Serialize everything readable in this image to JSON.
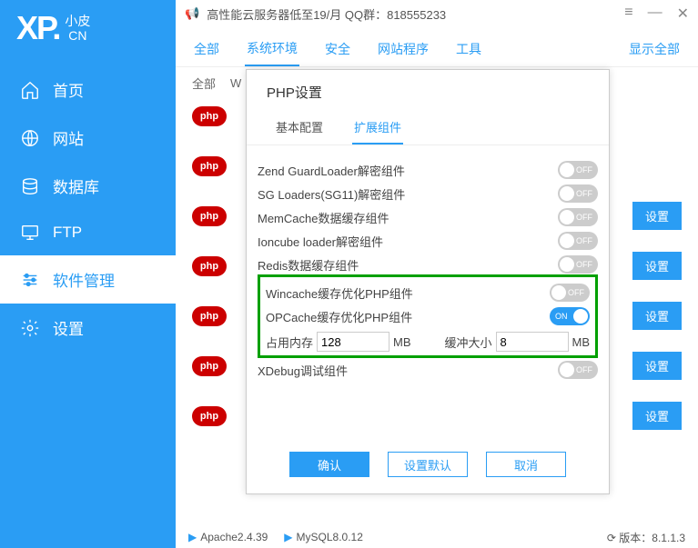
{
  "topbar": {
    "promo": "高性能云服务器低至19/月  QQ群：818555233"
  },
  "logo": {
    "main": "XP.",
    "top": "小皮",
    "bottom": "CN"
  },
  "nav": [
    {
      "label": "首页"
    },
    {
      "label": "网站"
    },
    {
      "label": "数据库"
    },
    {
      "label": "FTP"
    },
    {
      "label": "软件管理"
    },
    {
      "label": "设置"
    }
  ],
  "tabs": {
    "items": [
      "全部",
      "系统环境",
      "安全",
      "网站程序",
      "工具"
    ],
    "show_all": "显示全部"
  },
  "subtabs": {
    "all": "全部",
    "w": "W"
  },
  "php_badge": "php",
  "row_btn": "设置",
  "modal": {
    "title": "PHP设置",
    "tabs": {
      "basic": "基本配置",
      "ext": "扩展组件"
    },
    "items": [
      {
        "label": "Zend GuardLoader解密组件",
        "on": false
      },
      {
        "label": "SG Loaders(SG11)解密组件",
        "on": false
      },
      {
        "label": "MemCache数据缓存组件",
        "on": false
      },
      {
        "label": "Ioncube loader解密组件",
        "on": false
      },
      {
        "label": "Redis数据缓存组件",
        "on": false
      },
      {
        "label": "Wincache缓存优化PHP组件",
        "on": false
      },
      {
        "label": "OPCache缓存优化PHP组件",
        "on": true
      },
      {
        "label": "XDebug调试组件",
        "on": false
      }
    ],
    "on_text": "ON",
    "off_text": "OFF",
    "mem_label": "占用内存",
    "mem_value": "128",
    "mem_unit": "MB",
    "cache_label": "缓冲大小",
    "cache_value": "8",
    "cache_unit": "MB",
    "ok": "确认",
    "defaults": "设置默认",
    "cancel": "取消"
  },
  "status": {
    "apache": "Apache2.4.39",
    "mysql": "MySQL8.0.12",
    "ver_label": "版本：",
    "ver": "8.1.1.3"
  }
}
